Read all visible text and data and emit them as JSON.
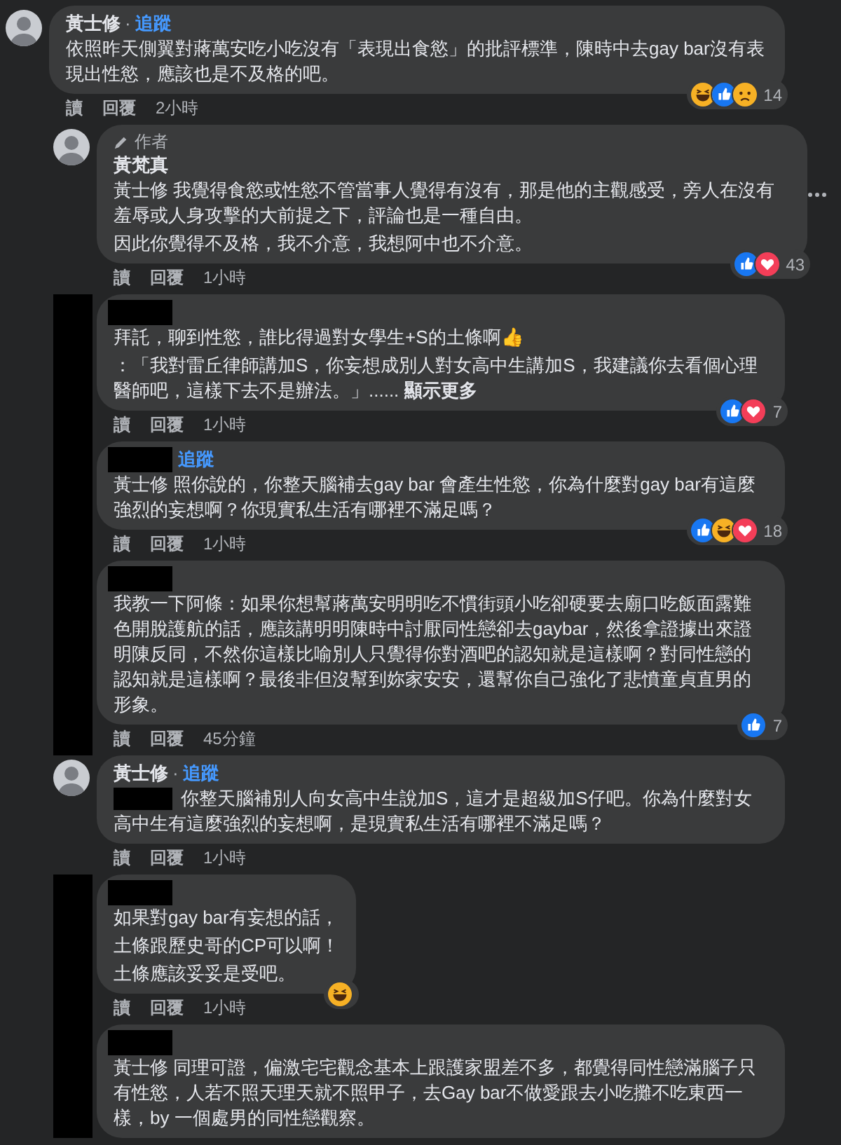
{
  "comments": [
    {
      "reply": false,
      "avatar": {
        "kind": "photo"
      },
      "author": "黃士修",
      "separator": "·",
      "follow": "追蹤",
      "paragraphs": [
        "依照昨天側翼對蔣萬安吃小吃沒有「表現出食慾」的批評標準，陳時中去gay bar沒有表現出性慾，應該也是不及格的吧。"
      ],
      "reactions": [
        {
          "kind": "haha"
        },
        {
          "kind": "like"
        },
        {
          "kind": "sad"
        }
      ],
      "reaction_count": "14",
      "actions": [
        "讀",
        "回覆"
      ],
      "time": "2小時"
    },
    {
      "reply": true,
      "avatar": {
        "kind": "photo"
      },
      "badge": "作者",
      "author": "黃梵真",
      "paragraphs": [
        "黃士修 我覺得食慾或性慾不管當事人覺得有沒有，那是他的主觀感受，旁人在沒有羞辱或人身攻擊的大前提之下，評論也是一種自由。",
        "因此你覺得不及格，我不介意，我想阿中也不介意。"
      ],
      "more_menu": true,
      "reactions": [
        {
          "kind": "like"
        },
        {
          "kind": "love"
        }
      ],
      "reaction_count": "43",
      "actions": [
        "讀",
        "回覆"
      ],
      "time": "1小時"
    },
    {
      "reply": true,
      "avatar": {
        "kind": "redacted"
      },
      "author_redacted": true,
      "paragraphs": [
        "拜託，聊到性慾，誰比得過對女學生+S的土條啊👍",
        "：「我對雷丘律師講加S，你妄想成別人對女高中生講加S，我建議你去看個心理醫師吧，這樣下去不是辦法。」......"
      ],
      "see_more": "顯示更多",
      "reactions": [
        {
          "kind": "like"
        },
        {
          "kind": "love"
        }
      ],
      "reaction_count": "7",
      "actions": [
        "讀",
        "回覆"
      ],
      "time": "1小時"
    },
    {
      "reply": true,
      "avatar": {
        "kind": "redacted"
      },
      "author_redacted": true,
      "follow": "追蹤",
      "paragraphs": [
        "黃士修 照你說的，你整天腦補去gay bar 會產生性慾，你為什麼對gay bar有這麼強烈的妄想啊？你現實私生活有哪裡不滿足嗎？"
      ],
      "reactions": [
        {
          "kind": "like"
        },
        {
          "kind": "haha"
        },
        {
          "kind": "love"
        }
      ],
      "reaction_count": "18",
      "actions": [
        "讀",
        "回覆"
      ],
      "time": "1小時"
    },
    {
      "reply": true,
      "avatar": {
        "kind": "redacted"
      },
      "author_redacted": true,
      "paragraphs": [
        "我教一下阿條：如果你想幫蔣萬安明明吃不慣街頭小吃卻硬要去廟口吃飯面露難色開脫護航的話，應該講明明陳時中討厭同性戀卻去gaybar，然後拿證據出來證明陳反同，不然你這樣比喻別人只覺得你對酒吧的認知就是這樣啊？對同性戀的認知就是這樣啊？最後非但沒幫到妳家安安，還幫你自己強化了悲憤童貞直男的形象。"
      ],
      "reactions": [
        {
          "kind": "like"
        }
      ],
      "reaction_count": "7",
      "actions": [
        "讀",
        "回覆"
      ],
      "time": "45分鐘"
    },
    {
      "reply": true,
      "avatar": {
        "kind": "photo"
      },
      "author": "黃士修",
      "separator": "·",
      "follow": "追蹤",
      "mention_redacted": true,
      "paragraphs": [
        "你整天腦補別人向女高中生說加S，這才是超級加S仔吧。你為什麼對女高中生有這麼強烈的妄想啊，是現實私生活有哪裡不滿足嗎？"
      ],
      "actions": [
        "讀",
        "回覆"
      ],
      "time": "1小時"
    },
    {
      "reply": true,
      "avatar": {
        "kind": "redacted"
      },
      "author_redacted": true,
      "paragraphs": [
        "如果對gay bar有妄想的話，",
        "土條跟歷史哥的CP可以啊！",
        "土條應該妥妥是受吧。"
      ],
      "reactions": [
        {
          "kind": "haha"
        }
      ],
      "actions": [
        "讀",
        "回覆"
      ],
      "time": "1小時"
    },
    {
      "reply": true,
      "avatar": {
        "kind": "redacted"
      },
      "author_redacted": true,
      "paragraphs": [
        "黃士修 同理可證，偏激宅宅觀念基本上跟護家盟差不多，都覺得同性戀滿腦子只有性慾，人若不照天理天就不照甲子，去Gay bar不做愛跟去小吃攤不吃東西一樣，by 一個處男的同性戀觀察。"
      ]
    }
  ]
}
